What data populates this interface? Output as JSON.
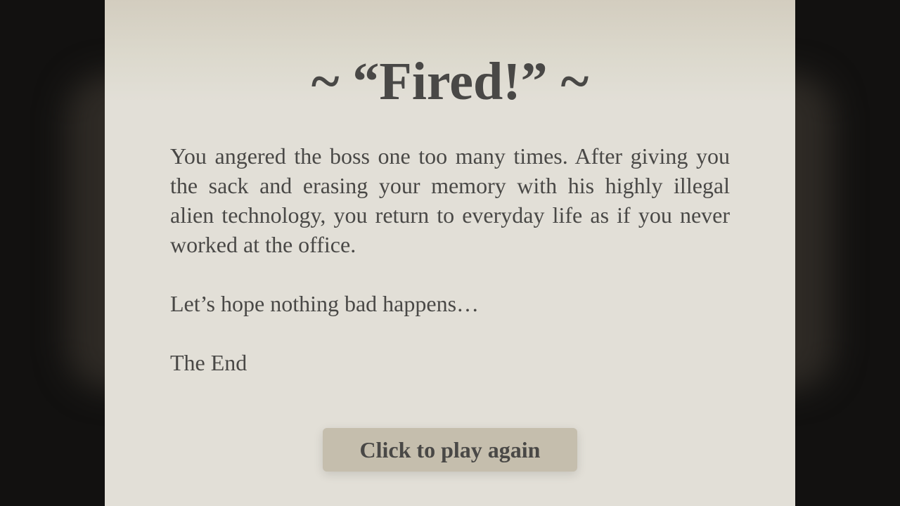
{
  "ending": {
    "title": "~ “Fired!” ~",
    "paragraphs": [
      "You angered the boss one too many times. After giving you the sack and erasing your memory with his highly illegal alien technology, you return to everyday life as if you never worked at the office.",
      "Let’s hope nothing bad happens…",
      "The End"
    ],
    "button_label": "Click to play again"
  },
  "colors": {
    "text": "#494846",
    "paper": "#e2dfd7",
    "button": "#c5bead",
    "background": "#121110"
  }
}
